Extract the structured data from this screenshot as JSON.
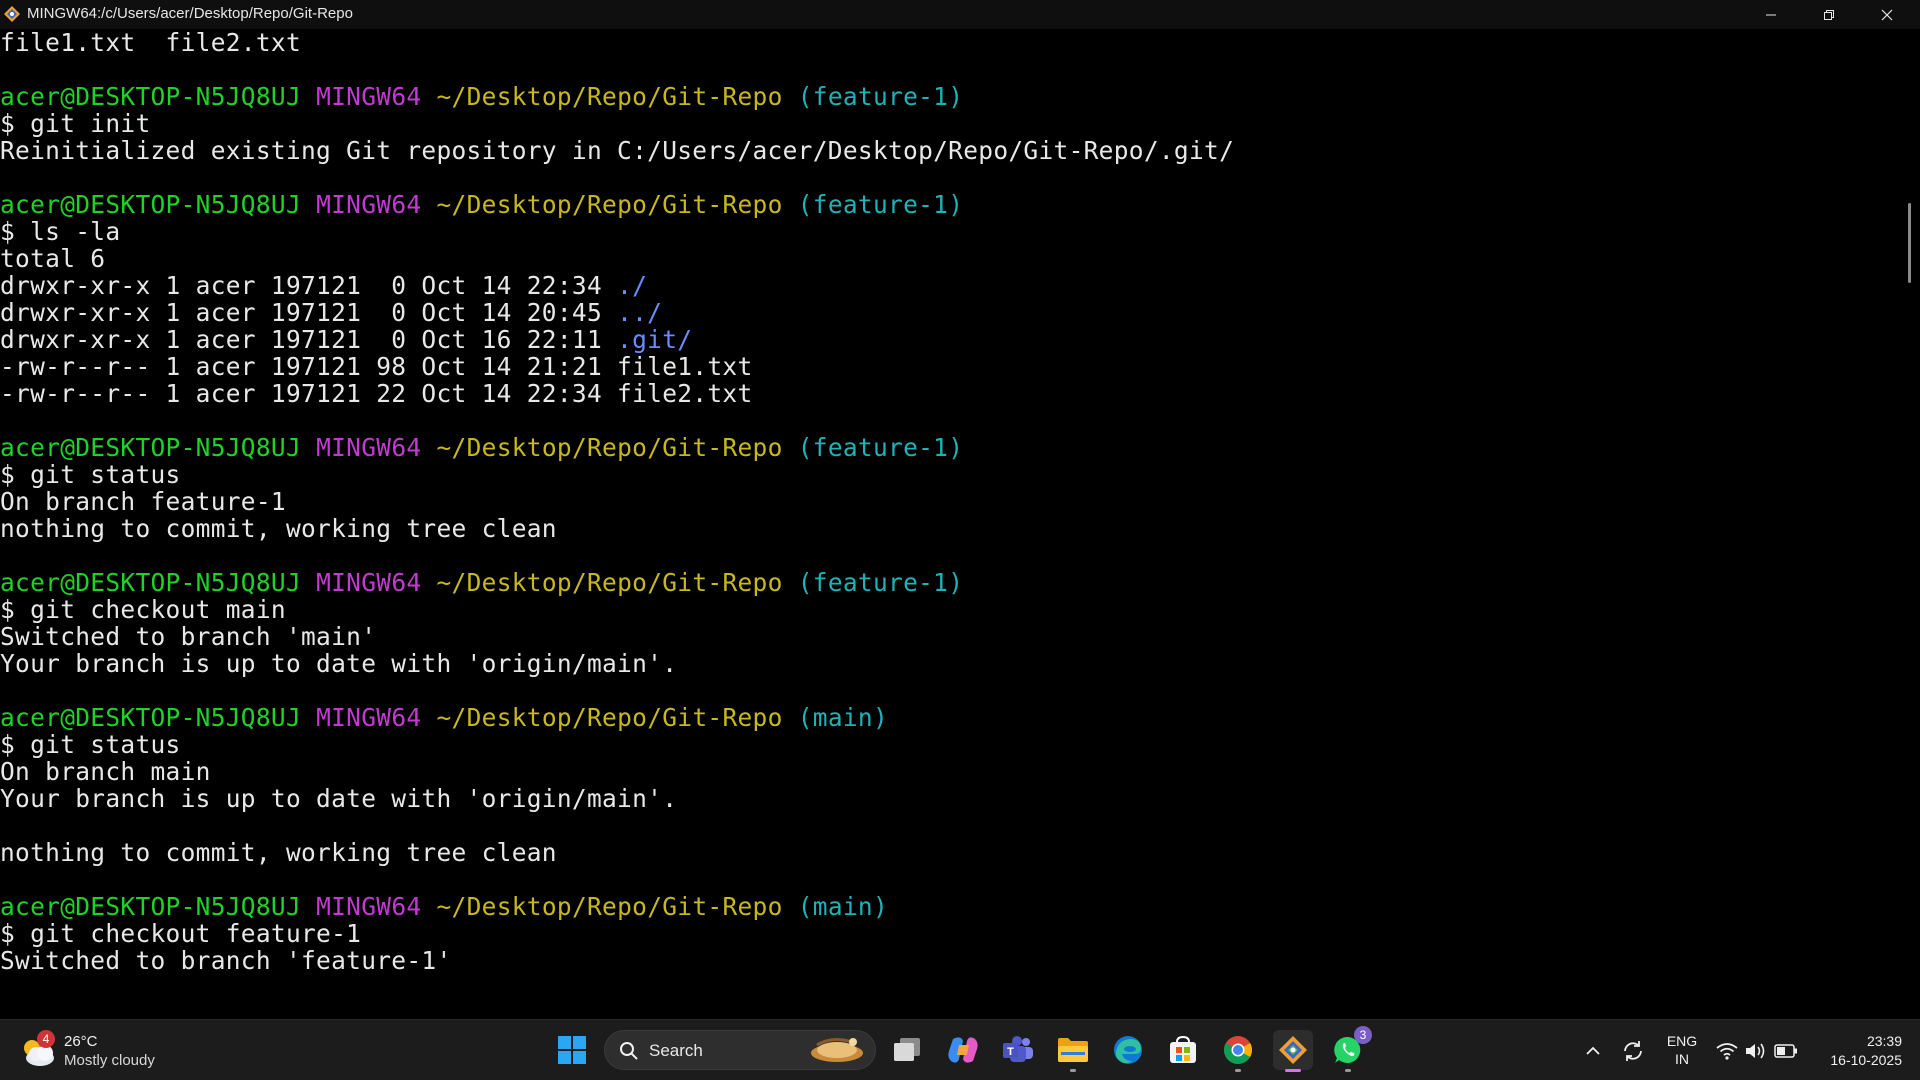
{
  "window": {
    "title": "MINGW64:/c/Users/acer/Desktop/Repo/Git-Repo",
    "controls": [
      "minimize",
      "restore",
      "close"
    ]
  },
  "terminal": {
    "lines": [
      {
        "segments": [
          {
            "t": "file1.txt  file2.txt",
            "c": "white"
          }
        ]
      },
      {
        "segments": []
      },
      {
        "segments": [
          {
            "t": "acer@DESKTOP-N5JQ8UJ",
            "c": "user"
          },
          {
            "t": " ",
            "c": "white"
          },
          {
            "t": "MINGW64",
            "c": "sys"
          },
          {
            "t": " ",
            "c": "white"
          },
          {
            "t": "~/Desktop/Repo/Git-Repo",
            "c": "path"
          },
          {
            "t": " ",
            "c": "white"
          },
          {
            "t": "(feature-1)",
            "c": "branch"
          }
        ]
      },
      {
        "segments": [
          {
            "t": "$ git init",
            "c": "white"
          }
        ]
      },
      {
        "segments": [
          {
            "t": "Reinitialized existing Git repository in C:/Users/acer/Desktop/Repo/Git-Repo/.git/",
            "c": "white"
          }
        ]
      },
      {
        "segments": []
      },
      {
        "segments": [
          {
            "t": "acer@DESKTOP-N5JQ8UJ",
            "c": "user"
          },
          {
            "t": " ",
            "c": "white"
          },
          {
            "t": "MINGW64",
            "c": "sys"
          },
          {
            "t": " ",
            "c": "white"
          },
          {
            "t": "~/Desktop/Repo/Git-Repo",
            "c": "path"
          },
          {
            "t": " ",
            "c": "white"
          },
          {
            "t": "(feature-1)",
            "c": "branch"
          }
        ]
      },
      {
        "segments": [
          {
            "t": "$ ls -la",
            "c": "white"
          }
        ]
      },
      {
        "segments": [
          {
            "t": "total 6",
            "c": "white"
          }
        ]
      },
      {
        "segments": [
          {
            "t": "drwxr-xr-x 1 acer 197121  0 Oct 14 22:34 ",
            "c": "white"
          },
          {
            "t": "./",
            "c": "dir"
          }
        ]
      },
      {
        "segments": [
          {
            "t": "drwxr-xr-x 1 acer 197121  0 Oct 14 20:45 ",
            "c": "white"
          },
          {
            "t": "../",
            "c": "dir"
          }
        ]
      },
      {
        "segments": [
          {
            "t": "drwxr-xr-x 1 acer 197121  0 Oct 16 22:11 ",
            "c": "white"
          },
          {
            "t": ".git/",
            "c": "dir"
          }
        ]
      },
      {
        "segments": [
          {
            "t": "-rw-r--r-- 1 acer 197121 98 Oct 14 21:21 file1.txt",
            "c": "white"
          }
        ]
      },
      {
        "segments": [
          {
            "t": "-rw-r--r-- 1 acer 197121 22 Oct 14 22:34 file2.txt",
            "c": "white"
          }
        ]
      },
      {
        "segments": []
      },
      {
        "segments": [
          {
            "t": "acer@DESKTOP-N5JQ8UJ",
            "c": "user"
          },
          {
            "t": " ",
            "c": "white"
          },
          {
            "t": "MINGW64",
            "c": "sys"
          },
          {
            "t": " ",
            "c": "white"
          },
          {
            "t": "~/Desktop/Repo/Git-Repo",
            "c": "path"
          },
          {
            "t": " ",
            "c": "white"
          },
          {
            "t": "(feature-1)",
            "c": "branch"
          }
        ]
      },
      {
        "segments": [
          {
            "t": "$ git status",
            "c": "white"
          }
        ]
      },
      {
        "segments": [
          {
            "t": "On branch feature-1",
            "c": "white"
          }
        ]
      },
      {
        "segments": [
          {
            "t": "nothing to commit, working tree clean",
            "c": "white"
          }
        ]
      },
      {
        "segments": []
      },
      {
        "segments": [
          {
            "t": "acer@DESKTOP-N5JQ8UJ",
            "c": "user"
          },
          {
            "t": " ",
            "c": "white"
          },
          {
            "t": "MINGW64",
            "c": "sys"
          },
          {
            "t": " ",
            "c": "white"
          },
          {
            "t": "~/Desktop/Repo/Git-Repo",
            "c": "path"
          },
          {
            "t": " ",
            "c": "white"
          },
          {
            "t": "(feature-1)",
            "c": "branch"
          }
        ]
      },
      {
        "segments": [
          {
            "t": "$ git checkout main",
            "c": "white"
          }
        ]
      },
      {
        "segments": [
          {
            "t": "Switched to branch 'main'",
            "c": "white"
          }
        ]
      },
      {
        "segments": [
          {
            "t": "Your branch is up to date with 'origin/main'.",
            "c": "white"
          }
        ]
      },
      {
        "segments": []
      },
      {
        "segments": [
          {
            "t": "acer@DESKTOP-N5JQ8UJ",
            "c": "user"
          },
          {
            "t": " ",
            "c": "white"
          },
          {
            "t": "MINGW64",
            "c": "sys"
          },
          {
            "t": " ",
            "c": "white"
          },
          {
            "t": "~/Desktop/Repo/Git-Repo",
            "c": "path"
          },
          {
            "t": " ",
            "c": "white"
          },
          {
            "t": "(main)",
            "c": "branch"
          }
        ]
      },
      {
        "segments": [
          {
            "t": "$ git status",
            "c": "white"
          }
        ]
      },
      {
        "segments": [
          {
            "t": "On branch main",
            "c": "white"
          }
        ]
      },
      {
        "segments": [
          {
            "t": "Your branch is up to date with 'origin/main'.",
            "c": "white"
          }
        ]
      },
      {
        "segments": []
      },
      {
        "segments": [
          {
            "t": "nothing to commit, working tree clean",
            "c": "white"
          }
        ]
      },
      {
        "segments": []
      },
      {
        "segments": [
          {
            "t": "acer@DESKTOP-N5JQ8UJ",
            "c": "user"
          },
          {
            "t": " ",
            "c": "white"
          },
          {
            "t": "MINGW64",
            "c": "sys"
          },
          {
            "t": " ",
            "c": "white"
          },
          {
            "t": "~/Desktop/Repo/Git-Repo",
            "c": "path"
          },
          {
            "t": " ",
            "c": "white"
          },
          {
            "t": "(main)",
            "c": "branch"
          }
        ]
      },
      {
        "segments": [
          {
            "t": "$ git checkout feature-1",
            "c": "white"
          }
        ]
      },
      {
        "segments": [
          {
            "t": "Switched to branch 'feature-1'",
            "c": "white"
          }
        ]
      }
    ],
    "colors": {
      "background": "#000000",
      "user": "#1fd226",
      "sys": "#c13bd0",
      "path": "#c7b81f",
      "branch": "#1fb2b7",
      "dir": "#6a8cff",
      "text": "#e8e8e8"
    }
  },
  "taskbar": {
    "weather": {
      "badge": "4",
      "temp": "26°C",
      "condition": "Mostly cloudy",
      "icon": "partly-cloudy-icon"
    },
    "search": {
      "label": "Search"
    },
    "apps": [
      {
        "name": "start-button",
        "icon": "windows-start-icon"
      },
      {
        "name": "task-view",
        "icon": "task-view-icon"
      },
      {
        "name": "copilot",
        "icon": "copilot-icon"
      },
      {
        "name": "teams",
        "icon": "teams-icon"
      },
      {
        "name": "file-explorer",
        "icon": "folder-icon"
      },
      {
        "name": "edge",
        "icon": "edge-icon"
      },
      {
        "name": "microsoft-store",
        "icon": "store-icon"
      },
      {
        "name": "chrome",
        "icon": "chrome-icon"
      },
      {
        "name": "git-bash",
        "icon": "git-bash-icon"
      },
      {
        "name": "whatsapp",
        "icon": "whatsapp-icon",
        "badge": "3"
      }
    ],
    "tray": {
      "language_line1": "ENG",
      "language_line2": "IN",
      "time": "23:39",
      "date": "16-10-2025"
    }
  }
}
